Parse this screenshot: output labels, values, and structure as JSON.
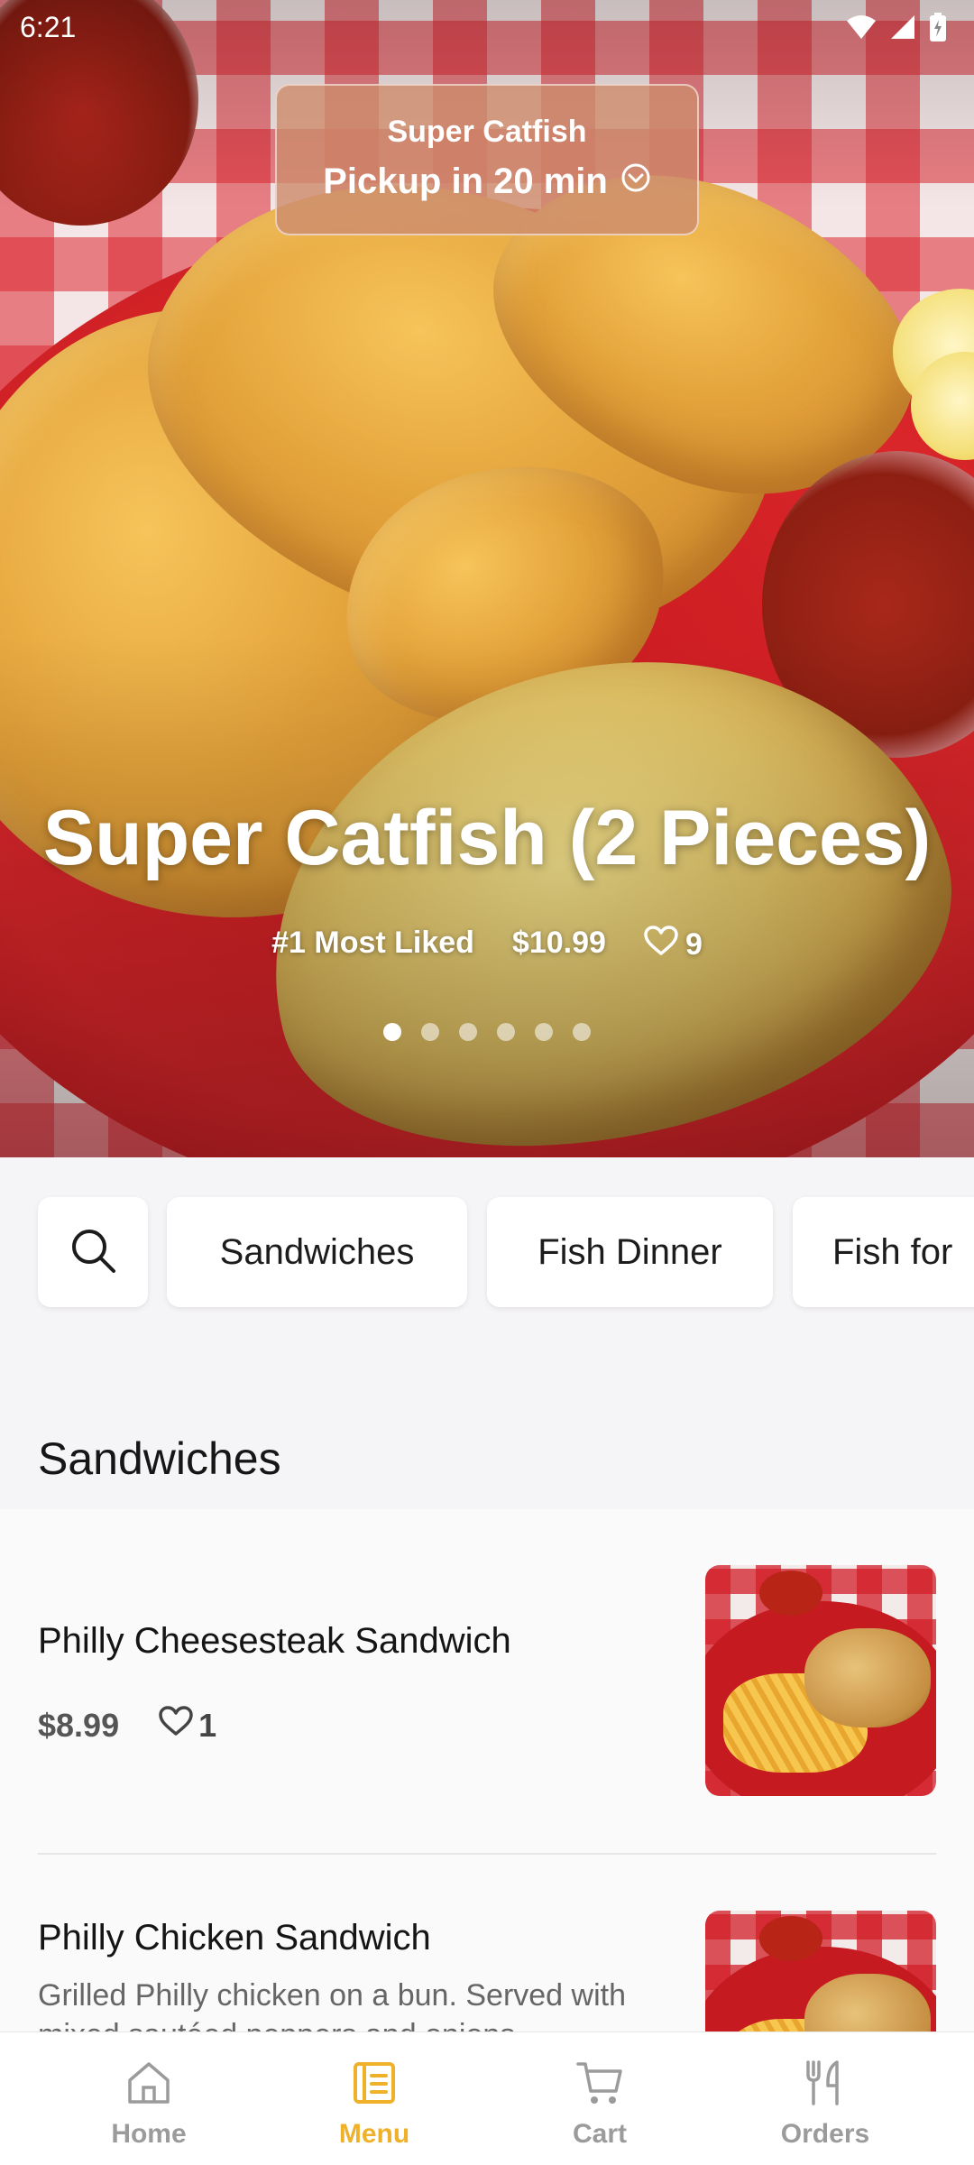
{
  "status_bar": {
    "time": "6:21"
  },
  "pickup": {
    "restaurant": "Super Catfish",
    "label": "Pickup in 20 min"
  },
  "hero": {
    "title": "Super Catfish (2 Pieces)",
    "rank": "#1 Most Liked",
    "price": "$10.99",
    "likes": "9",
    "slide_count": 6,
    "active_slide": 1
  },
  "categories": [
    "Sandwiches",
    "Fish Dinner",
    "Fish for"
  ],
  "section": {
    "title": "Sandwiches"
  },
  "items": [
    {
      "name": "Philly Cheesesteak Sandwich",
      "price": "$8.99",
      "likes": "1"
    },
    {
      "name": "Philly Chicken Sandwich",
      "description": "Grilled Philly chicken on a bun. Served with mixed sautéed peppers and onions"
    }
  ],
  "nav": {
    "items": [
      {
        "label": "Home",
        "icon": "home-icon"
      },
      {
        "label": "Menu",
        "icon": "menu-icon",
        "active": true
      },
      {
        "label": "Cart",
        "icon": "cart-icon"
      },
      {
        "label": "Orders",
        "icon": "orders-icon"
      }
    ],
    "active_color": "#f0b12a",
    "inactive_color": "#9b9b9b"
  }
}
